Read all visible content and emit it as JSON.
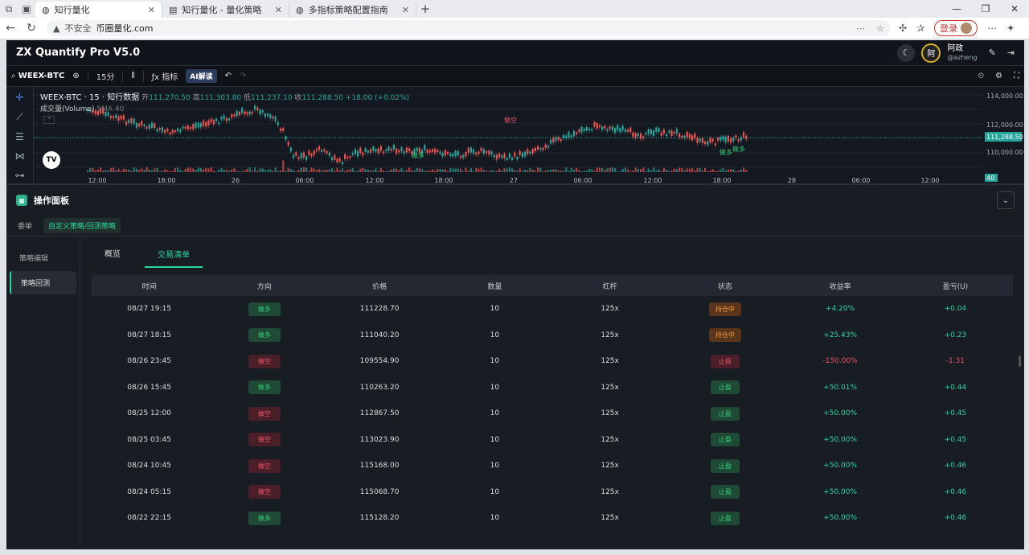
{
  "browser": {
    "tabs": [
      {
        "label": "知行量化",
        "active": true
      },
      {
        "label": "知行量化 - 量化策略",
        "active": false
      },
      {
        "label": "多指标策略配置指南",
        "active": false
      }
    ],
    "security": "不安全",
    "url": "币圈量化.com",
    "login": "登录"
  },
  "app": {
    "brand": "ZX Quantify Pro V5.0",
    "user": {
      "avatar": "阿",
      "name": "阿政",
      "handle": "@azheng"
    }
  },
  "toolbar": {
    "symbol": "WEEX-BTC",
    "interval": "15分",
    "indicator": "指标",
    "ai": "AI解读"
  },
  "chart": {
    "legend": {
      "title": "WEEX-BTC · 15 · 知行数据",
      "open_label": "开",
      "open": "111,270.50",
      "high_label": "高",
      "high": "111,303.80",
      "low_label": "低",
      "low": "111,237.10",
      "close_label": "收",
      "close": "111,288.50",
      "change": "+18.00 (+0.02%)"
    },
    "volume_legend": "成交量(Volume)",
    "volume_sma": "SMA",
    "volume_value": "40",
    "logo": "TV",
    "y_ticks": [
      "114,000.00",
      "112,000.00",
      "110,000.00"
    ],
    "last_price": "111,288.50",
    "volume_tag": "40",
    "x_ticks": [
      "12:00",
      "18:00",
      "26",
      "06:00",
      "12:00",
      "18:00",
      "27",
      "06:00",
      "12:00",
      "18:00",
      "28",
      "06:00",
      "12:00"
    ],
    "signals": [
      "做空",
      "做多",
      "做多",
      "做多"
    ],
    "colors": {
      "up": "#26a69a",
      "down": "#ef5350"
    }
  },
  "panel": {
    "title": "操作面板",
    "subtabs": [
      "委单",
      "自定义策略/回测策略"
    ],
    "side": [
      "策略编辑",
      "策略回测"
    ],
    "tabs": [
      "概览",
      "交易清单"
    ],
    "columns": [
      "时间",
      "方向",
      "价格",
      "数量",
      "杠杆",
      "状态",
      "收益率",
      "盈亏(U)"
    ],
    "rows": [
      {
        "time": "08/27 19:15",
        "dir": "做多",
        "price": "111228.70",
        "qty": "10",
        "lev": "125x",
        "status": "持仓中",
        "ret": "+4.20%",
        "pnl": "+0.04"
      },
      {
        "time": "08/27 18:15",
        "dir": "做多",
        "price": "111040.20",
        "qty": "10",
        "lev": "125x",
        "status": "持仓中",
        "ret": "+25.43%",
        "pnl": "+0.23"
      },
      {
        "time": "08/26 23:45",
        "dir": "做空",
        "price": "109554.90",
        "qty": "10",
        "lev": "125x",
        "status": "止损",
        "ret": "-150.00%",
        "pnl": "-1.31"
      },
      {
        "time": "08/26 15:45",
        "dir": "做多",
        "price": "110263.20",
        "qty": "10",
        "lev": "125x",
        "status": "止盈",
        "ret": "+50.01%",
        "pnl": "+0.44"
      },
      {
        "time": "08/25 12:00",
        "dir": "做空",
        "price": "112867.50",
        "qty": "10",
        "lev": "125x",
        "status": "止盈",
        "ret": "+50.00%",
        "pnl": "+0.45"
      },
      {
        "time": "08/25 03:45",
        "dir": "做空",
        "price": "113023.90",
        "qty": "10",
        "lev": "125x",
        "status": "止盈",
        "ret": "+50.00%",
        "pnl": "+0.45"
      },
      {
        "time": "08/24 10:45",
        "dir": "做空",
        "price": "115168.00",
        "qty": "10",
        "lev": "125x",
        "status": "止盈",
        "ret": "+50.00%",
        "pnl": "+0.46"
      },
      {
        "time": "08/24 05:15",
        "dir": "做空",
        "price": "115068.70",
        "qty": "10",
        "lev": "125x",
        "status": "止盈",
        "ret": "+50.00%",
        "pnl": "+0.46"
      },
      {
        "time": "08/22 22:15",
        "dir": "做多",
        "price": "115128.20",
        "qty": "10",
        "lev": "125x",
        "status": "止盈",
        "ret": "+50.00%",
        "pnl": "+0.46"
      }
    ]
  }
}
